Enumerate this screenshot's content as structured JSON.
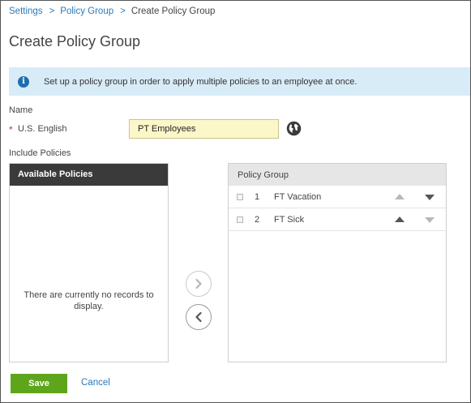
{
  "breadcrumb": {
    "items": [
      "Settings",
      "Policy Group",
      "Create Policy Group"
    ],
    "separator": ">"
  },
  "page": {
    "title": "Create Policy Group"
  },
  "info_banner": {
    "icon": "info-icon",
    "icon_glyph": "i",
    "text": "Set up a policy group in order to apply multiple policies to an employee at once."
  },
  "form": {
    "name_label": "Name",
    "required_marker": "*",
    "language_label": "U.S. English",
    "name_value": "PT Employees",
    "include_label": "Include Policies"
  },
  "available_policies": {
    "header": "Available Policies",
    "empty_message": "There are currently no records to display."
  },
  "policy_group": {
    "header": "Policy Group",
    "rows": [
      {
        "number": "1",
        "name": "FT Vacation",
        "up_enabled": false,
        "down_enabled": true
      },
      {
        "number": "2",
        "name": "FT Sick",
        "up_enabled": true,
        "down_enabled": false
      }
    ]
  },
  "actions": {
    "save_label": "Save",
    "cancel_label": "Cancel"
  },
  "colors": {
    "link": "#2a7ab8",
    "banner_bg": "#d8ecf8",
    "input_bg": "#fbf7c8",
    "dark_header": "#3a3a3a",
    "save_green": "#5fa51c"
  }
}
